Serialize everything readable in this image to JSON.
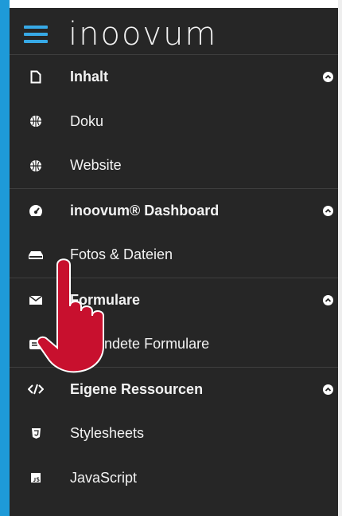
{
  "brand": {
    "logo_text": "inoovum"
  },
  "menu": [
    {
      "label": "Inhalt",
      "icon": "file-icon",
      "section": true
    },
    {
      "label": "Doku",
      "icon": "globe-icon",
      "section": false
    },
    {
      "label": "Website",
      "icon": "globe-icon",
      "section": false
    },
    {
      "label": "inoovum® Dashboard",
      "icon": "dashboard-gauge-icon",
      "section": true
    },
    {
      "label": "Fotos & Dateien",
      "icon": "hard-drive-icon",
      "section": false
    },
    {
      "label": "Formulare",
      "icon": "envelope-icon",
      "section": true
    },
    {
      "label": "Gesendete Formulare",
      "icon": "envelope-sent-icon",
      "section": false
    },
    {
      "label": "Eigene Ressourcen",
      "icon": "code-icon",
      "section": true
    },
    {
      "label": "Stylesheets",
      "icon": "css3-icon",
      "section": false
    },
    {
      "label": "JavaScript",
      "icon": "js-file-icon",
      "section": false
    }
  ],
  "colors": {
    "accent": "#1e9ad8",
    "hamburger": "#37a9e6",
    "panel_bg": "#262626",
    "text": "#f2f2f2",
    "hand": "#c8102e"
  }
}
